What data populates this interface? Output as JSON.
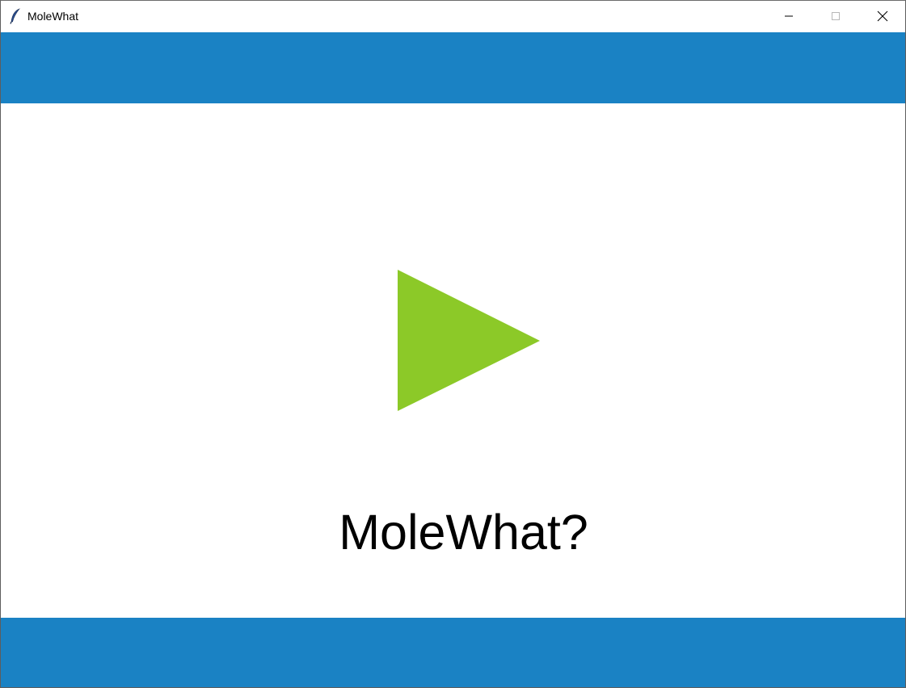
{
  "window": {
    "title": "MoleWhat",
    "icon": "feather-icon",
    "controls": {
      "minimize_icon": "minimize-icon",
      "maximize_icon": "maximize-icon",
      "close_icon": "close-icon"
    }
  },
  "main": {
    "play_icon": "play-icon",
    "heading": "MoleWhat?"
  },
  "colors": {
    "accent": "#1a82c4",
    "play": "#8cc928",
    "background": "#ffffff",
    "text": "#000000"
  }
}
